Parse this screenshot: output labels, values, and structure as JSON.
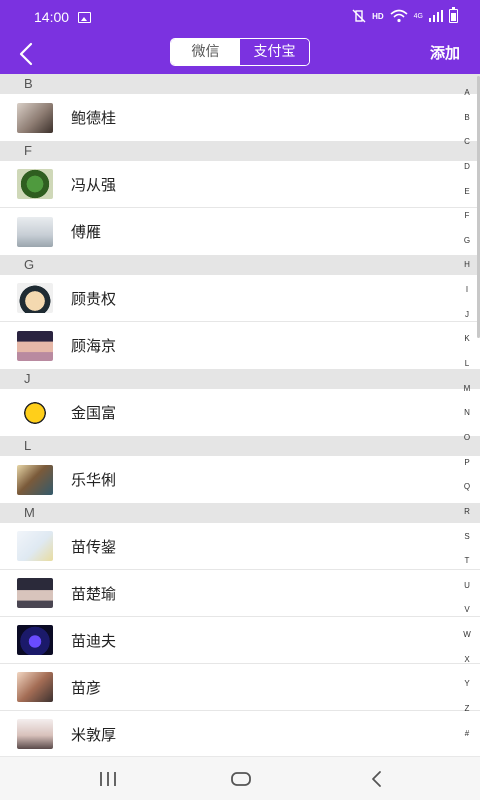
{
  "status_bar": {
    "time": "14:00",
    "hd": "HD",
    "network": "4G"
  },
  "header": {
    "tabs": [
      {
        "label": "微信",
        "active": false
      },
      {
        "label": "支付宝",
        "active": true
      }
    ],
    "add_label": "添加"
  },
  "colors": {
    "accent": "#7b32e0",
    "section_bg": "#e5e5e5"
  },
  "icons": {
    "back": "chevron-left-icon",
    "nav_recents": "recents-icon",
    "nav_home": "home-icon",
    "nav_back": "back-icon"
  },
  "sections": [
    {
      "letter": "B",
      "contacts": [
        "鲍德桂"
      ]
    },
    {
      "letter": "F",
      "contacts": [
        "冯从强",
        "傅雁"
      ]
    },
    {
      "letter": "G",
      "contacts": [
        "顾贵权",
        "顾海京"
      ]
    },
    {
      "letter": "J",
      "contacts": [
        "金国富"
      ]
    },
    {
      "letter": "L",
      "contacts": [
        "乐华俐"
      ]
    },
    {
      "letter": "M",
      "contacts": [
        "苗传鋆",
        "苗楚瑜",
        "苗迪夫",
        "苗彦",
        "米敦厚"
      ]
    }
  ],
  "index_letters": [
    "A",
    "B",
    "C",
    "D",
    "E",
    "F",
    "G",
    "H",
    "I",
    "J",
    "K",
    "L",
    "M",
    "N",
    "O",
    "P",
    "Q",
    "R",
    "S",
    "T",
    "U",
    "V",
    "W",
    "X",
    "Y",
    "Z",
    "#"
  ]
}
